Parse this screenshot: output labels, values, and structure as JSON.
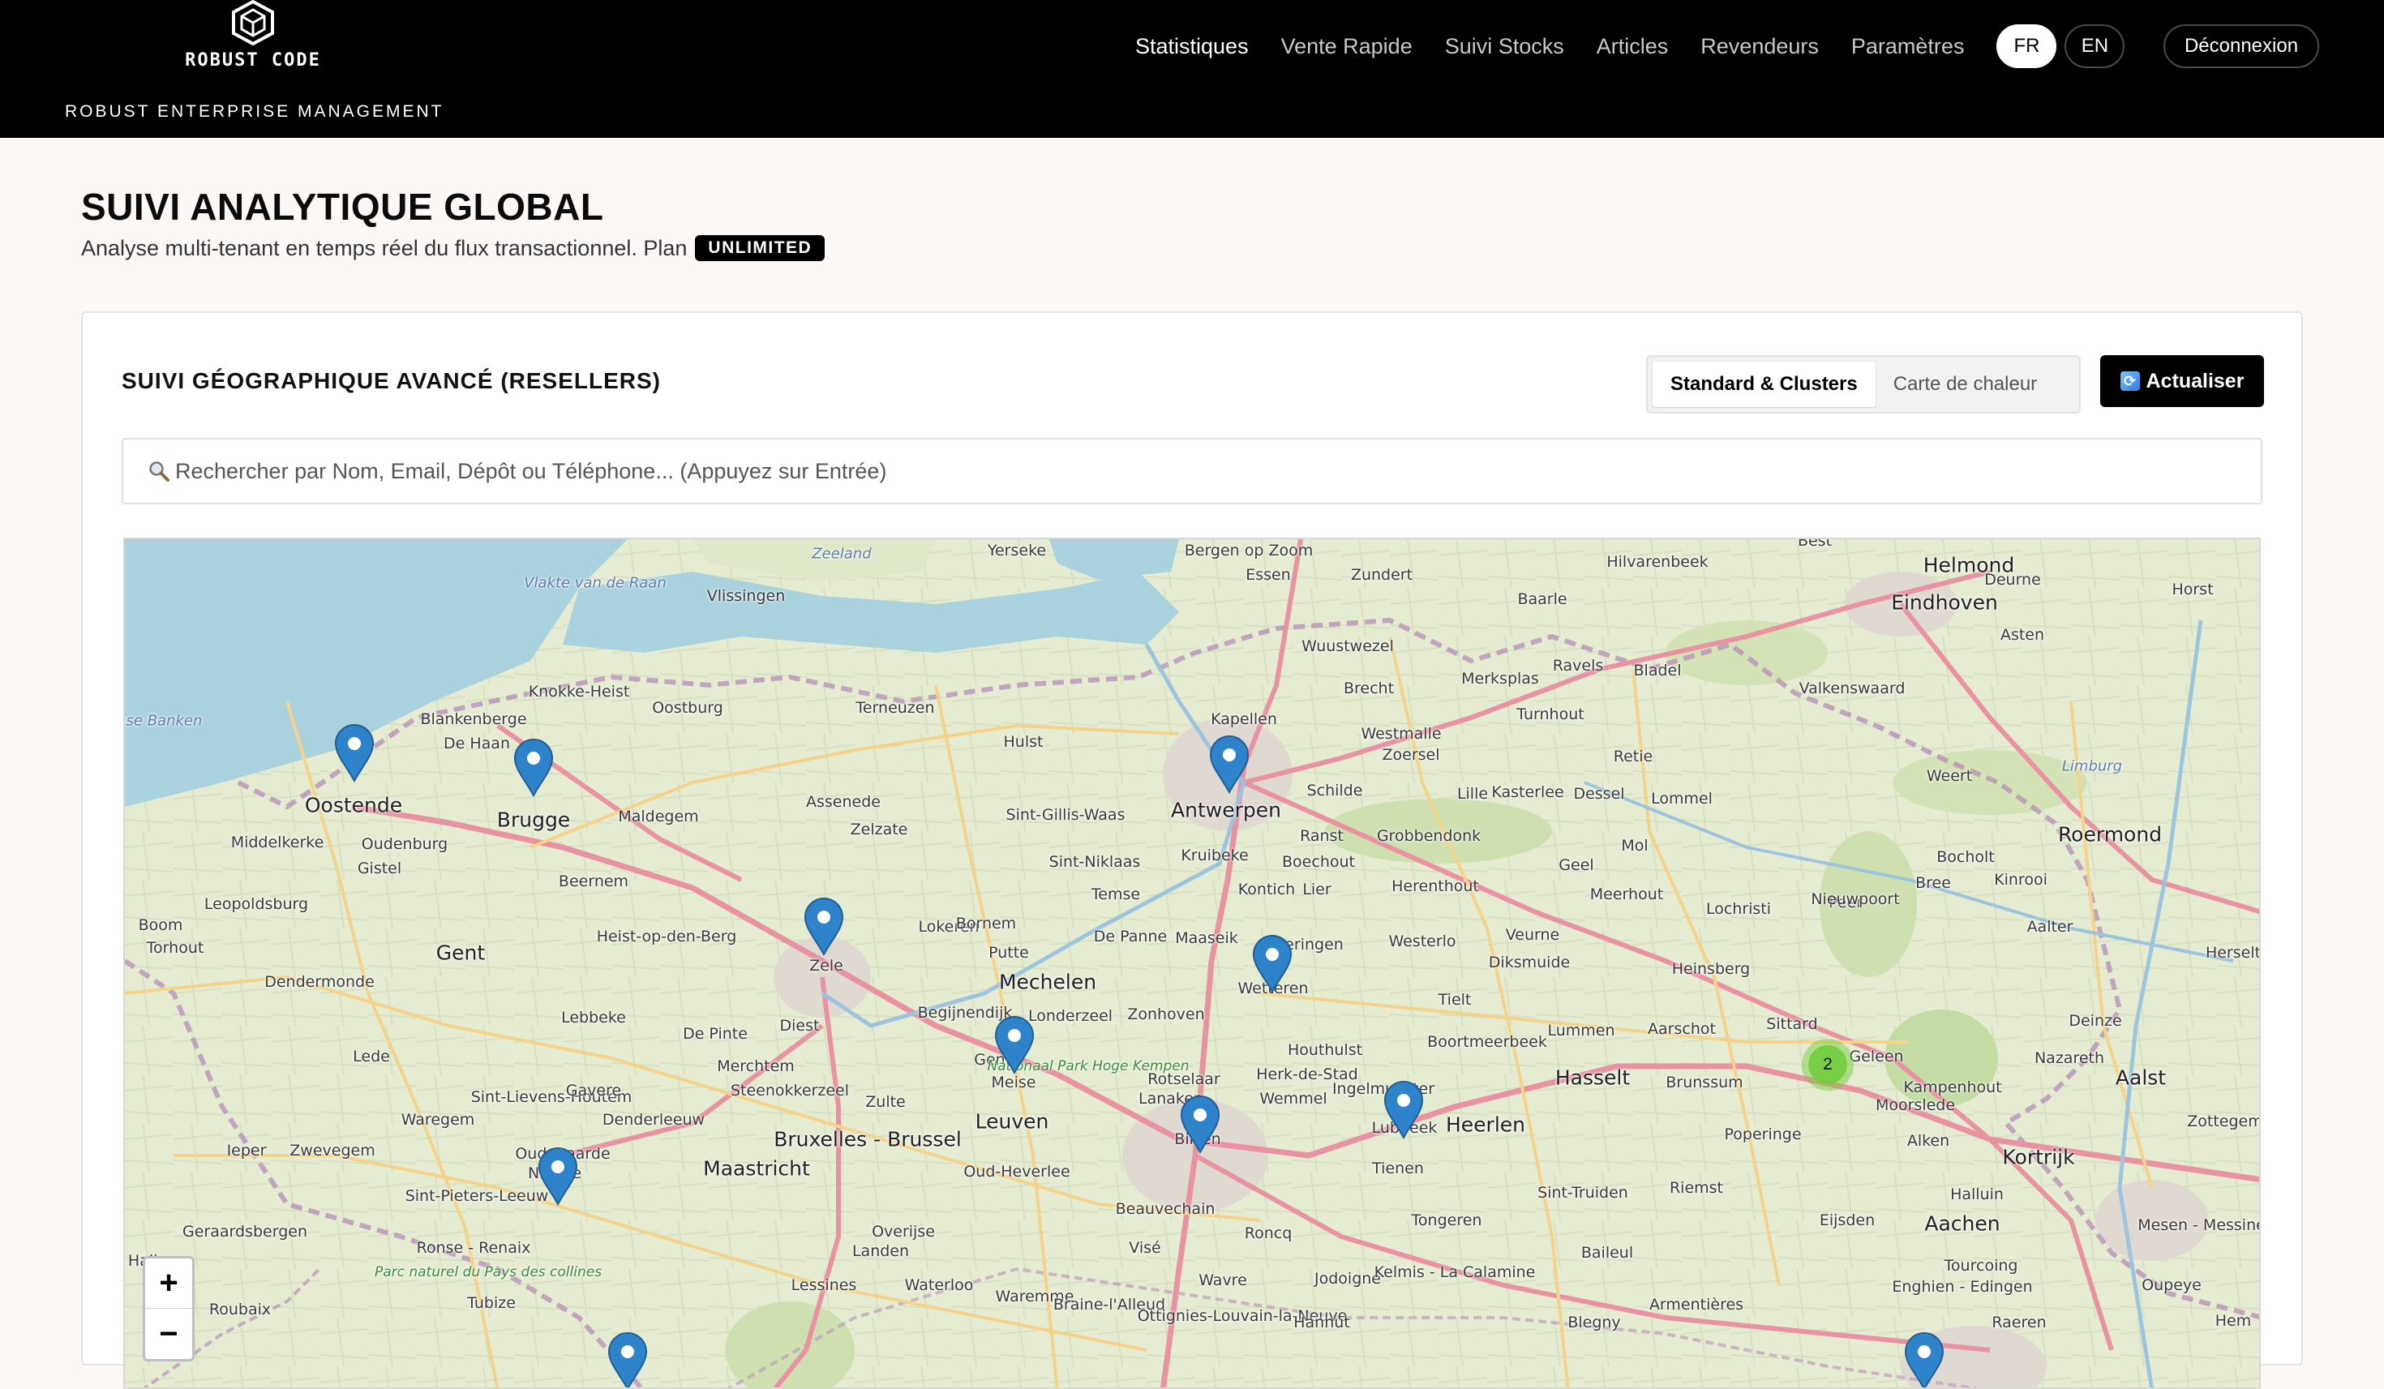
{
  "brand": {
    "name": "ROBUST CODE",
    "tagline": "ROBUST ENTERPRISE MANAGEMENT",
    "logo_icon": "cube-logo-icon"
  },
  "nav": {
    "items": [
      {
        "label": "Statistiques",
        "active": true
      },
      {
        "label": "Vente Rapide",
        "active": false
      },
      {
        "label": "Suivi Stocks",
        "active": false
      },
      {
        "label": "Articles",
        "active": false
      },
      {
        "label": "Revendeurs",
        "active": false
      },
      {
        "label": "Paramètres",
        "active": false
      }
    ],
    "languages": [
      {
        "label": "FR",
        "selected": true
      },
      {
        "label": "EN",
        "selected": false
      }
    ],
    "logout_label": "Déconnexion"
  },
  "page": {
    "title": "SUIVI ANALYTIQUE GLOBAL",
    "subtitle": "Analyse multi-tenant en temps réel du flux transactionnel. Plan",
    "plan_badge": "UNLIMITED"
  },
  "card": {
    "title": "SUIVI GÉOGRAPHIQUE AVANCÉ (RESELLERS)",
    "view_options": [
      {
        "label": "Standard & Clusters",
        "selected": true
      },
      {
        "label": "Carte de chaleur",
        "selected": false
      }
    ],
    "refresh_label": "Actualiser",
    "search_placeholder": "Rechercher par Nom, Email, Dépôt ou Téléphone... (Appuyez sur Entrée)"
  },
  "map": {
    "zoom_in_label": "+",
    "zoom_out_label": "−",
    "cluster_count": "2",
    "labels": [
      {
        "text": "Zeeland",
        "kind": "water"
      },
      {
        "text": "Yerseke",
        "kind": "city"
      },
      {
        "text": "Bergen op Zoom",
        "kind": "city"
      },
      {
        "text": "Essen",
        "kind": "city"
      },
      {
        "text": "Zundert",
        "kind": "city"
      },
      {
        "text": "Hilvarenbeek",
        "kind": "city"
      },
      {
        "text": "Best",
        "kind": "city"
      },
      {
        "text": "Helmond",
        "kind": "big"
      },
      {
        "text": "Deurne",
        "kind": "city"
      },
      {
        "text": "Horst",
        "kind": "city"
      },
      {
        "text": "Eindhoven",
        "kind": "big"
      },
      {
        "text": "Vlissingen",
        "kind": "city"
      },
      {
        "text": "Vlakte van de Raan",
        "kind": "water"
      },
      {
        "text": "Baarle",
        "kind": "city"
      },
      {
        "text": "Asten",
        "kind": "city"
      },
      {
        "text": "Wuustwezel",
        "kind": "city"
      },
      {
        "text": "Ravels",
        "kind": "city"
      },
      {
        "text": "Bladel",
        "kind": "city"
      },
      {
        "text": "Merksplas",
        "kind": "city"
      },
      {
        "text": "Brecht",
        "kind": "city"
      },
      {
        "text": "Valkenswaard",
        "kind": "city"
      },
      {
        "text": "Knokke-Heist",
        "kind": "city"
      },
      {
        "text": "Oostburg",
        "kind": "city"
      },
      {
        "text": "Terneuzen",
        "kind": "city"
      },
      {
        "text": "Kapellen",
        "kind": "city"
      },
      {
        "text": "Turnhout",
        "kind": "city"
      },
      {
        "text": "Vlaamse Banken",
        "kind": "water"
      },
      {
        "text": "Blankenberge",
        "kind": "city"
      },
      {
        "text": "Westmalle",
        "kind": "city"
      },
      {
        "text": "Hulst",
        "kind": "city"
      },
      {
        "text": "De Haan",
        "kind": "city"
      },
      {
        "text": "Zoersel",
        "kind": "city"
      },
      {
        "text": "Retie",
        "kind": "city"
      },
      {
        "text": "Limburg",
        "kind": "water"
      },
      {
        "text": "Weert",
        "kind": "city"
      },
      {
        "text": "Oostende",
        "kind": "big"
      },
      {
        "text": "Brugge",
        "kind": "big"
      },
      {
        "text": "Assenede",
        "kind": "city"
      },
      {
        "text": "Sint-Gillis-Waas",
        "kind": "city"
      },
      {
        "text": "Antwerpen",
        "kind": "big"
      },
      {
        "text": "Schilde",
        "kind": "city"
      },
      {
        "text": "Lille",
        "kind": "city"
      },
      {
        "text": "Kasterlee",
        "kind": "city"
      },
      {
        "text": "Dessel",
        "kind": "city"
      },
      {
        "text": "Lommel",
        "kind": "city"
      },
      {
        "text": "Maldegem",
        "kind": "city"
      },
      {
        "text": "Zelzate",
        "kind": "city"
      },
      {
        "text": "Middelkerke",
        "kind": "city"
      },
      {
        "text": "Oudenburg",
        "kind": "city"
      },
      {
        "text": "Roermond",
        "kind": "big"
      },
      {
        "text": "Ranst",
        "kind": "city"
      },
      {
        "text": "Grobbendonk",
        "kind": "city"
      },
      {
        "text": "Bocholt",
        "kind": "city"
      },
      {
        "text": "Sint-Niklaas",
        "kind": "city"
      },
      {
        "text": "Kruibeke",
        "kind": "city"
      },
      {
        "text": "Boechout",
        "kind": "city"
      },
      {
        "text": "Mol",
        "kind": "city"
      },
      {
        "text": "Gistel",
        "kind": "city"
      },
      {
        "text": "Geel",
        "kind": "city"
      },
      {
        "text": "Bree",
        "kind": "city"
      },
      {
        "text": "Kinrooi",
        "kind": "city"
      },
      {
        "text": "Beernem",
        "kind": "city"
      },
      {
        "text": "Temse",
        "kind": "city"
      },
      {
        "text": "Kontich",
        "kind": "city"
      },
      {
        "text": "Lier",
        "kind": "city"
      },
      {
        "text": "Herenthout",
        "kind": "city"
      },
      {
        "text": "Meerhout",
        "kind": "city"
      },
      {
        "text": "Peer",
        "kind": "city"
      },
      {
        "text": "Nieuwpoort",
        "kind": "city"
      },
      {
        "text": "Leopoldsburg",
        "kind": "city"
      },
      {
        "text": "Lochristi",
        "kind": "city"
      },
      {
        "text": "Lokeren",
        "kind": "city"
      },
      {
        "text": "Bornem",
        "kind": "city"
      },
      {
        "text": "De Panne",
        "kind": "city"
      },
      {
        "text": "Boom",
        "kind": "city"
      },
      {
        "text": "Maaseik",
        "kind": "city"
      },
      {
        "text": "Aalter",
        "kind": "city"
      },
      {
        "text": "Heist-op-den-Berg",
        "kind": "city"
      },
      {
        "text": "Westerlo",
        "kind": "city"
      },
      {
        "text": "Veurne",
        "kind": "city"
      },
      {
        "text": "Torhout",
        "kind": "city"
      },
      {
        "text": "Gent",
        "kind": "big"
      },
      {
        "text": "Zele",
        "kind": "city"
      },
      {
        "text": "Putte",
        "kind": "city"
      },
      {
        "text": "Beringen",
        "kind": "city"
      },
      {
        "text": "Heinsberg",
        "kind": "city"
      },
      {
        "text": "Herselt",
        "kind": "city"
      },
      {
        "text": "Diksmuide",
        "kind": "city"
      },
      {
        "text": "Dendermonde",
        "kind": "city"
      },
      {
        "text": "Mechelen",
        "kind": "big"
      },
      {
        "text": "Wetteren",
        "kind": "city"
      },
      {
        "text": "Begijnendijk",
        "kind": "city"
      },
      {
        "text": "Tielt",
        "kind": "city"
      },
      {
        "text": "Lebbeke",
        "kind": "city"
      },
      {
        "text": "Londerzeel",
        "kind": "city"
      },
      {
        "text": "Zonhoven",
        "kind": "city"
      },
      {
        "text": "Sittard",
        "kind": "city"
      },
      {
        "text": "Deinze",
        "kind": "city"
      },
      {
        "text": "De Pinte",
        "kind": "city"
      },
      {
        "text": "Diest",
        "kind": "city"
      },
      {
        "text": "Lummen",
        "kind": "city"
      },
      {
        "text": "Aarschot",
        "kind": "city"
      },
      {
        "text": "Boortmeerbeek",
        "kind": "city"
      },
      {
        "text": "Houthulst",
        "kind": "city"
      },
      {
        "text": "Lede",
        "kind": "city"
      },
      {
        "text": "Genk",
        "kind": "city"
      },
      {
        "text": "Geleen",
        "kind": "city"
      },
      {
        "text": "Nazareth",
        "kind": "city"
      },
      {
        "text": "Merchtem",
        "kind": "city"
      },
      {
        "text": "Nationaal Park Hoge Kempen",
        "kind": "park"
      },
      {
        "text": "Kampenhout",
        "kind": "city"
      },
      {
        "text": "Herk-de-Stad",
        "kind": "city"
      },
      {
        "text": "Hasselt",
        "kind": "big"
      },
      {
        "text": "Brunssum",
        "kind": "city"
      },
      {
        "text": "Aalst",
        "kind": "big"
      },
      {
        "text": "Meise",
        "kind": "city"
      },
      {
        "text": "Rotselaar",
        "kind": "city"
      },
      {
        "text": "Ingelmunster",
        "kind": "city"
      },
      {
        "text": "Sint-Lievens-Houtem",
        "kind": "city"
      },
      {
        "text": "Zulte",
        "kind": "city"
      },
      {
        "text": "Gavere",
        "kind": "city"
      },
      {
        "text": "Steenokkerzeel",
        "kind": "city"
      },
      {
        "text": "Wemmel",
        "kind": "city"
      },
      {
        "text": "Lanaken",
        "kind": "city"
      },
      {
        "text": "Moorslede",
        "kind": "city"
      },
      {
        "text": "Waregem",
        "kind": "city"
      },
      {
        "text": "Denderleeuw",
        "kind": "city"
      },
      {
        "text": "Leuven",
        "kind": "big"
      },
      {
        "text": "Lubbeek",
        "kind": "city"
      },
      {
        "text": "Heerlen",
        "kind": "big"
      },
      {
        "text": "Zottegem",
        "kind": "city"
      },
      {
        "text": "Bruxelles - Brussel",
        "kind": "big"
      },
      {
        "text": "Bilzen",
        "kind": "city"
      },
      {
        "text": "Alken",
        "kind": "city"
      },
      {
        "text": "Poperinge",
        "kind": "city"
      },
      {
        "text": "Ieper",
        "kind": "city"
      },
      {
        "text": "Zwevegem",
        "kind": "city"
      },
      {
        "text": "Oudenaarde",
        "kind": "city"
      },
      {
        "text": "Maastricht",
        "kind": "big"
      },
      {
        "text": "Kortrijk",
        "kind": "big"
      },
      {
        "text": "Ninove",
        "kind": "city"
      },
      {
        "text": "Oud-Heverlee",
        "kind": "city"
      },
      {
        "text": "Tienen",
        "kind": "city"
      },
      {
        "text": "Sint-Truiden",
        "kind": "city"
      },
      {
        "text": "Riemst",
        "kind": "city"
      },
      {
        "text": "Halluin",
        "kind": "city"
      },
      {
        "text": "Sint-Pieters-Leeuw",
        "kind": "city"
      },
      {
        "text": "Beauvechain",
        "kind": "city"
      },
      {
        "text": "Tongeren",
        "kind": "city"
      },
      {
        "text": "Eijsden",
        "kind": "city"
      },
      {
        "text": "Aachen",
        "kind": "big"
      },
      {
        "text": "Mesen - Messines",
        "kind": "city"
      },
      {
        "text": "Geraardsbergen",
        "kind": "city"
      },
      {
        "text": "Overijse",
        "kind": "city"
      },
      {
        "text": "Roncq",
        "kind": "city"
      },
      {
        "text": "Ronse - Renaix",
        "kind": "city"
      },
      {
        "text": "Landen",
        "kind": "city"
      },
      {
        "text": "Baileul",
        "kind": "city"
      },
      {
        "text": "Halle",
        "kind": "city"
      },
      {
        "text": "Visé",
        "kind": "city"
      },
      {
        "text": "Tourcoing",
        "kind": "city"
      },
      {
        "text": "Parc naturel du Pays des collines",
        "kind": "park"
      },
      {
        "text": "Lessines",
        "kind": "city"
      },
      {
        "text": "Waterloo",
        "kind": "city"
      },
      {
        "text": "Wavre",
        "kind": "city"
      },
      {
        "text": "Jodoigne",
        "kind": "city"
      },
      {
        "text": "Kelmis - La Calamine",
        "kind": "city"
      },
      {
        "text": "Oupeye",
        "kind": "city"
      },
      {
        "text": "Enghien - Edingen",
        "kind": "city"
      },
      {
        "text": "Waremme",
        "kind": "city"
      },
      {
        "text": "Armentières",
        "kind": "city"
      },
      {
        "text": "Roubaix",
        "kind": "city"
      },
      {
        "text": "Tubize",
        "kind": "city"
      },
      {
        "text": "Braine-l'Alleud",
        "kind": "city"
      },
      {
        "text": "Ottignies-Louvain-la-Neuve",
        "kind": "city"
      },
      {
        "text": "Hannut",
        "kind": "city"
      },
      {
        "text": "Blegny",
        "kind": "city"
      },
      {
        "text": "Raeren",
        "kind": "city"
      },
      {
        "text": "Hem",
        "kind": "city"
      }
    ]
  }
}
